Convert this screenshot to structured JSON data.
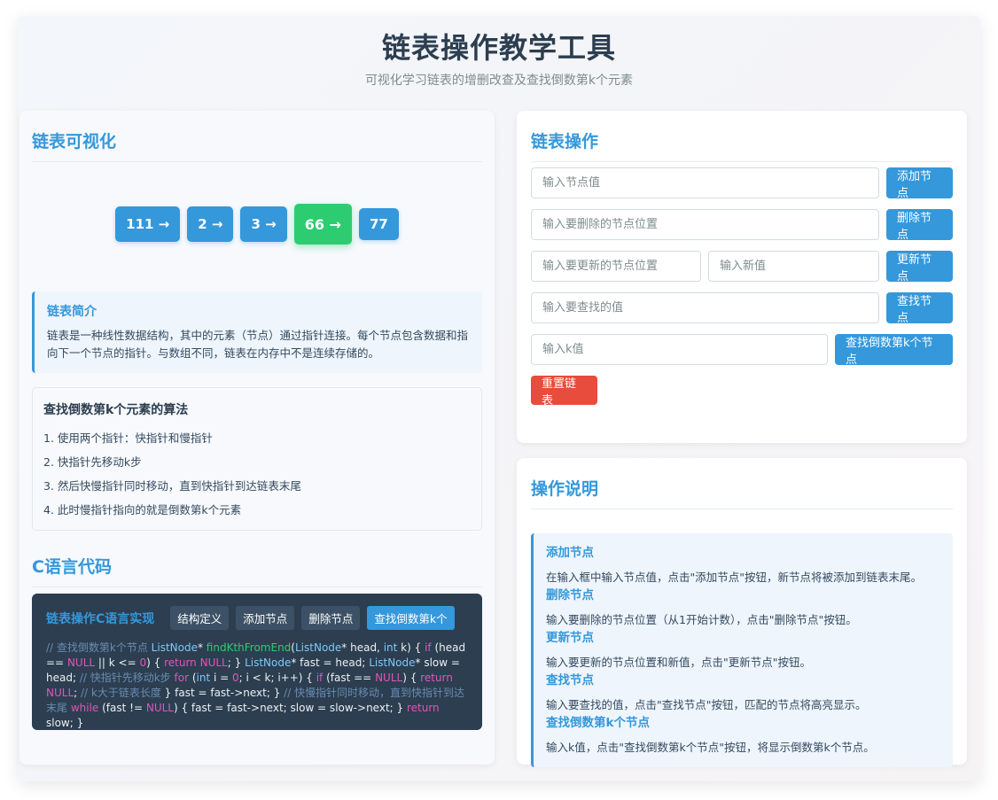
{
  "header": {
    "title": "链表操作教学工具",
    "subtitle": "可视化学习链表的增删改查及查找倒数第k个元素"
  },
  "visual": {
    "title": "链表可视化",
    "nodes": [
      {
        "label": "111 →",
        "highlight": false
      },
      {
        "label": "2 →",
        "highlight": false
      },
      {
        "label": "3 →",
        "highlight": false
      },
      {
        "label": "66 →",
        "highlight": true
      },
      {
        "label": "77",
        "highlight": false
      }
    ]
  },
  "intro": {
    "title": "链表简介",
    "text": "链表是一种线性数据结构，其中的元素（节点）通过指针连接。每个节点包含数据和指向下一个节点的指针。与数组不同，链表在内存中不是连续存储的。"
  },
  "algorithm": {
    "title": "查找倒数第k个元素的算法",
    "steps": [
      "1. 使用两个指针：快指针和慢指针",
      "2. 快指针先移动k步",
      "3. 然后快慢指针同时移动，直到快指针到达链表末尾",
      "4. 此时慢指针指向的就是倒数第k个元素"
    ]
  },
  "code": {
    "section_title": "C语言代码",
    "panel_title": "链表操作C语言实现",
    "tabs": [
      "结构定义",
      "添加节点",
      "删除节点",
      "查找倒数第k个"
    ],
    "active_tab": 3,
    "tokens": [
      {
        "t": "// 查找倒数第k个节点 ",
        "c": "#6a8bb0"
      },
      {
        "t": "ListNode",
        "c": "#7fc8f8"
      },
      {
        "t": "* ",
        "c": "#ecf0f1"
      },
      {
        "t": "findKthFromEnd",
        "c": "#2ecc71"
      },
      {
        "t": "(",
        "c": "#ecf0f1"
      },
      {
        "t": "ListNode",
        "c": "#7fc8f8"
      },
      {
        "t": "* head, ",
        "c": "#ecf0f1"
      },
      {
        "t": "int",
        "c": "#7fc8f8"
      },
      {
        "t": " k) { ",
        "c": "#ecf0f1"
      },
      {
        "t": "if",
        "c": "#e056b8"
      },
      {
        "t": " (head == ",
        "c": "#ecf0f1"
      },
      {
        "t": "NULL",
        "c": "#e056b8"
      },
      {
        "t": " || k <= ",
        "c": "#ecf0f1"
      },
      {
        "t": "0",
        "c": "#e056b8"
      },
      {
        "t": ") { ",
        "c": "#ecf0f1"
      },
      {
        "t": "return",
        "c": "#e056b8"
      },
      {
        "t": " ",
        "c": "#ecf0f1"
      },
      {
        "t": "NULL",
        "c": "#e056b8"
      },
      {
        "t": "; } ",
        "c": "#ecf0f1"
      },
      {
        "t": "ListNode",
        "c": "#7fc8f8"
      },
      {
        "t": "* fast = head; ",
        "c": "#ecf0f1"
      },
      {
        "t": "ListNode",
        "c": "#7fc8f8"
      },
      {
        "t": "* slow = head; ",
        "c": "#ecf0f1"
      },
      {
        "t": "// 快指针先移动k步 ",
        "c": "#6a8bb0"
      },
      {
        "t": "for",
        "c": "#e056b8"
      },
      {
        "t": " (",
        "c": "#ecf0f1"
      },
      {
        "t": "int",
        "c": "#7fc8f8"
      },
      {
        "t": " i = ",
        "c": "#ecf0f1"
      },
      {
        "t": "0",
        "c": "#e056b8"
      },
      {
        "t": "; i < k; i++) { ",
        "c": "#ecf0f1"
      },
      {
        "t": "if",
        "c": "#e056b8"
      },
      {
        "t": " (fast == ",
        "c": "#ecf0f1"
      },
      {
        "t": "NULL",
        "c": "#e056b8"
      },
      {
        "t": ") { ",
        "c": "#ecf0f1"
      },
      {
        "t": "return",
        "c": "#e056b8"
      },
      {
        "t": " ",
        "c": "#ecf0f1"
      },
      {
        "t": "NULL",
        "c": "#e056b8"
      },
      {
        "t": "; ",
        "c": "#ecf0f1"
      },
      {
        "t": "// k大于链表长度 ",
        "c": "#6a8bb0"
      },
      {
        "t": "} fast = fast->next; } ",
        "c": "#ecf0f1"
      },
      {
        "t": "// 快慢指针同时移动，直到快指针到达末尾 ",
        "c": "#6a8bb0"
      },
      {
        "t": "while",
        "c": "#e056b8"
      },
      {
        "t": " (fast != ",
        "c": "#ecf0f1"
      },
      {
        "t": "NULL",
        "c": "#e056b8"
      },
      {
        "t": ") { fast = fast->next; slow = slow->next; } ",
        "c": "#ecf0f1"
      },
      {
        "t": "return",
        "c": "#e056b8"
      },
      {
        "t": " slow; }",
        "c": "#ecf0f1"
      }
    ]
  },
  "ops": {
    "title": "链表操作",
    "add_placeholder": "输入节点值",
    "add_button": "添加节点",
    "delete_placeholder": "输入要删除的节点位置",
    "delete_button": "删除节点",
    "update_pos_placeholder": "输入要更新的节点位置",
    "update_val_placeholder": "输入新值",
    "update_button": "更新节点",
    "find_placeholder": "输入要查找的值",
    "find_button": "查找节点",
    "k_placeholder": "输入k值",
    "k_button": "查找倒数第k个节点",
    "reset_button": "重置链表"
  },
  "guide": {
    "title": "操作说明",
    "items": [
      {
        "title": "添加节点",
        "text": "在输入框中输入节点值，点击\"添加节点\"按钮，新节点将被添加到链表末尾。"
      },
      {
        "title": "删除节点",
        "text": "输入要删除的节点位置（从1开始计数），点击\"删除节点\"按钮。"
      },
      {
        "title": "更新节点",
        "text": "输入要更新的节点位置和新值，点击\"更新节点\"按钮。"
      },
      {
        "title": "查找节点",
        "text": "输入要查找的值，点击\"查找节点\"按钮，匹配的节点将高亮显示。"
      },
      {
        "title": "查找倒数第k个节点",
        "text": "输入k值，点击\"查找倒数第k个节点\"按钮，将显示倒数第k个节点。"
      }
    ]
  },
  "colors": {
    "primary": "#3498db",
    "highlight": "#2ecc71",
    "danger": "#e74c3c",
    "code_bg": "#2c3e50"
  }
}
